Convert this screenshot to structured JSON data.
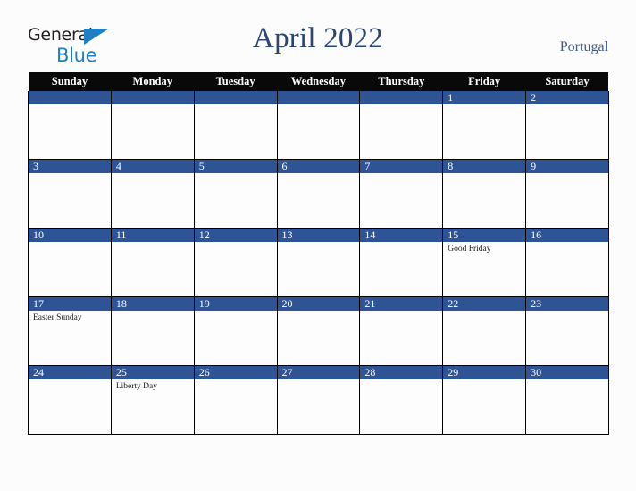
{
  "brand": {
    "name_part1": "General",
    "name_part2": "Blue",
    "triangle_icon": "triangle-icon",
    "accent_blue": "#1f7fc4",
    "dark": "#231f20"
  },
  "header": {
    "title": "April 2022",
    "country": "Portugal",
    "title_color": "#2b4771"
  },
  "calendar": {
    "weekday_headers": [
      "Sunday",
      "Monday",
      "Tuesday",
      "Wednesday",
      "Thursday",
      "Friday",
      "Saturday"
    ],
    "header_bg": "#090909",
    "daynum_bg": "#2f5496",
    "weeks": [
      [
        {
          "day": "",
          "event": ""
        },
        {
          "day": "",
          "event": ""
        },
        {
          "day": "",
          "event": ""
        },
        {
          "day": "",
          "event": ""
        },
        {
          "day": "",
          "event": ""
        },
        {
          "day": "1",
          "event": ""
        },
        {
          "day": "2",
          "event": ""
        }
      ],
      [
        {
          "day": "3",
          "event": ""
        },
        {
          "day": "4",
          "event": ""
        },
        {
          "day": "5",
          "event": ""
        },
        {
          "day": "6",
          "event": ""
        },
        {
          "day": "7",
          "event": ""
        },
        {
          "day": "8",
          "event": ""
        },
        {
          "day": "9",
          "event": ""
        }
      ],
      [
        {
          "day": "10",
          "event": ""
        },
        {
          "day": "11",
          "event": ""
        },
        {
          "day": "12",
          "event": ""
        },
        {
          "day": "13",
          "event": ""
        },
        {
          "day": "14",
          "event": ""
        },
        {
          "day": "15",
          "event": "Good Friday"
        },
        {
          "day": "16",
          "event": ""
        }
      ],
      [
        {
          "day": "17",
          "event": "Easter Sunday"
        },
        {
          "day": "18",
          "event": ""
        },
        {
          "day": "19",
          "event": ""
        },
        {
          "day": "20",
          "event": ""
        },
        {
          "day": "21",
          "event": ""
        },
        {
          "day": "22",
          "event": ""
        },
        {
          "day": "23",
          "event": ""
        }
      ],
      [
        {
          "day": "24",
          "event": ""
        },
        {
          "day": "25",
          "event": "Liberty Day"
        },
        {
          "day": "26",
          "event": ""
        },
        {
          "day": "27",
          "event": ""
        },
        {
          "day": "28",
          "event": ""
        },
        {
          "day": "29",
          "event": ""
        },
        {
          "day": "30",
          "event": ""
        }
      ]
    ]
  }
}
